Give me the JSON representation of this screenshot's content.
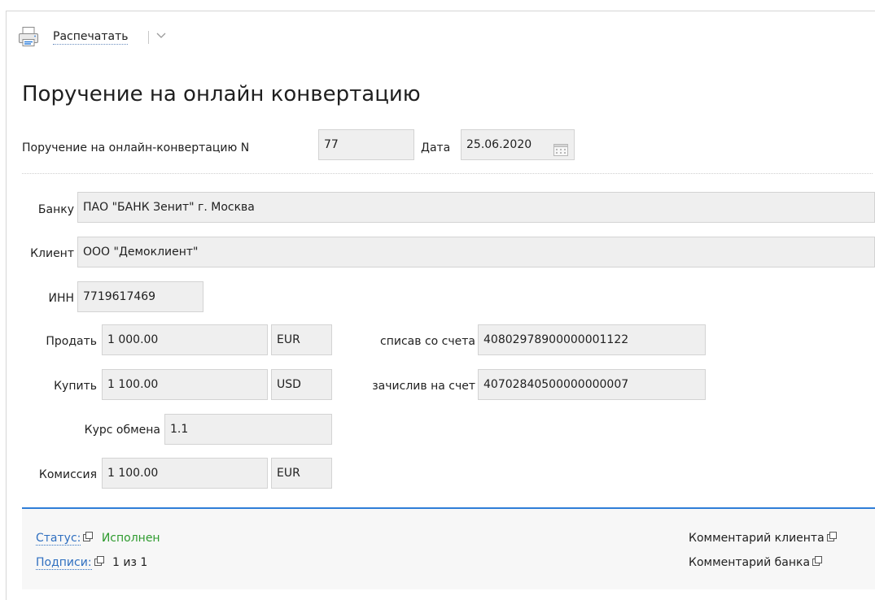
{
  "toolbar": {
    "print_label": "Распечатать",
    "print_icon": "printer-icon",
    "menu_icon": "chevron-down-icon"
  },
  "page": {
    "title": "Поручение на онлайн конвертацию"
  },
  "header": {
    "order_label": "Поручение на онлайн-конвертацию  N",
    "order_number": "77",
    "date_label": "Дата",
    "date_value": "25.06.2020",
    "date_icon": "calendar-icon"
  },
  "form": {
    "bank_label": "Банку",
    "bank_value": "ПАО \"БАНК Зенит\" г. Москва",
    "client_label": "Клиент",
    "client_value": "ООО \"Демоклиент\"",
    "inn_label": "ИНН",
    "inn_value": "7719617469",
    "sell_label": "Продать",
    "sell_amount": "1 000.00",
    "sell_currency": "EUR",
    "debit_label": "списав со счета",
    "debit_account": "40802978900000001122",
    "buy_label": "Купить",
    "buy_amount": "1 100.00",
    "buy_currency": "USD",
    "credit_label": "зачислив на счет",
    "credit_account": "40702840500000000007",
    "rate_label": "Курс обмена",
    "rate_value": "1.1",
    "fee_label": "Комиссия",
    "fee_amount": "1 100.00",
    "fee_currency": "EUR"
  },
  "status_panel": {
    "status_label": "Статус:",
    "status_value": "Исполнен",
    "signatures_label": "Подписи:",
    "signatures_value": "1 из 1",
    "client_comment_label": "Комментарий клиента",
    "bank_comment_label": "Комментарий банка",
    "open_icon": "external-window-icon"
  },
  "colors": {
    "accent": "#2f7ed8",
    "link": "#2f6fc0",
    "status_ok": "#2e9b2e",
    "field_bg": "#efefef"
  }
}
